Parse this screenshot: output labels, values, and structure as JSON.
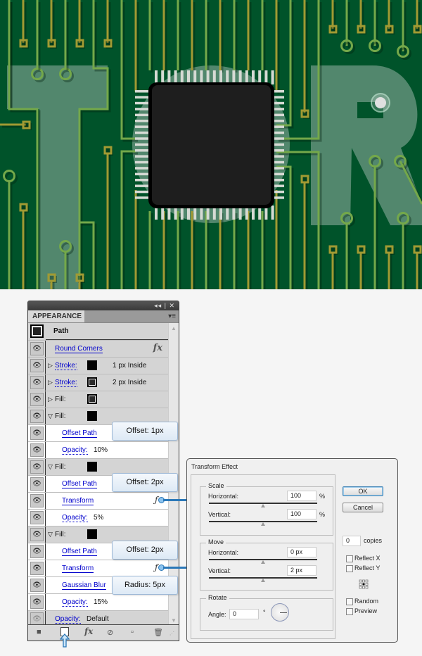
{
  "artwork": {
    "description": "circuit board illustration with a central microchip and translucent letters",
    "colors": {
      "board": "#00532a",
      "trace_green": "#74a84a",
      "trace_gold": "#a19a33",
      "letters": "#52876d",
      "chip": "#1e1e1e",
      "pins": "#d6dad4"
    }
  },
  "appearance_panel": {
    "window_controls": "◂◂ | ✕",
    "tab_label": "APPEARANCE",
    "menu_icon": "panel-menu-icon",
    "header": {
      "label": "Path"
    },
    "rows": [
      {
        "type": "effect",
        "label": "Round Corners",
        "icon": "fx-icon",
        "background": "grey"
      },
      {
        "type": "stroke",
        "label": "Stroke:",
        "swatch": "#000000",
        "value": "1 px  Inside",
        "expanded": false
      },
      {
        "type": "stroke",
        "label": "Stroke:",
        "swatch": "#2a2a2a",
        "value": "2 px  Inside",
        "expanded": false
      },
      {
        "type": "fill",
        "label": "Fill:",
        "swatch": "#2a2a2a",
        "expanded": false
      },
      {
        "type": "fill",
        "label": "Fill:",
        "swatch": "#000000",
        "expanded": true
      },
      {
        "type": "sub-effect",
        "label": "Offset Path"
      },
      {
        "type": "sub-opacity",
        "label": "Opacity:",
        "value": "10%"
      },
      {
        "type": "fill",
        "label": "Fill:",
        "swatch": "#000000",
        "expanded": true
      },
      {
        "type": "sub-effect",
        "label": "Offset Path"
      },
      {
        "type": "sub-effect",
        "label": "Transform",
        "linked": true
      },
      {
        "type": "sub-opacity",
        "label": "Opacity:",
        "value": "5%"
      },
      {
        "type": "fill",
        "label": "Fill:",
        "swatch": "#000000",
        "expanded": true
      },
      {
        "type": "sub-effect",
        "label": "Offset Path"
      },
      {
        "type": "sub-effect",
        "label": "Transform",
        "linked": true
      },
      {
        "type": "sub-effect",
        "label": "Gaussian Blur"
      },
      {
        "type": "sub-opacity",
        "label": "Opacity:",
        "value": "15%"
      },
      {
        "type": "opacity",
        "label": "Opacity:",
        "value": "Default"
      }
    ],
    "footer_buttons": [
      "stop-icon",
      "new-art-icon",
      "fx-menu-icon",
      "clear-icon",
      "duplicate-icon",
      "delete-icon"
    ]
  },
  "callouts": [
    {
      "text": "Offset: 1px"
    },
    {
      "text": "Offset: 2px"
    },
    {
      "text": "Offset: 2px"
    },
    {
      "text": "Radius: 5px"
    }
  ],
  "transform_dialog": {
    "title": "Transform Effect",
    "scale": {
      "title": "Scale",
      "horizontal_label": "Horizontal:",
      "horizontal_value": "100",
      "vertical_label": "Vertical:",
      "vertical_value": "100",
      "unit": "%"
    },
    "move": {
      "title": "Move",
      "horizontal_label": "Horizontal:",
      "horizontal_value": "0 px",
      "vertical_label": "Vertical:",
      "vertical_value": "2 px"
    },
    "rotate": {
      "title": "Rotate",
      "angle_label": "Angle:",
      "angle_value": "0",
      "degree_symbol": "°"
    },
    "ok_label": "OK",
    "cancel_label": "Cancel",
    "copies_value": "0",
    "copies_label": "copies",
    "reflect_x_label": "Reflect X",
    "reflect_y_label": "Reflect Y",
    "random_label": "Random",
    "preview_label": "Preview"
  }
}
